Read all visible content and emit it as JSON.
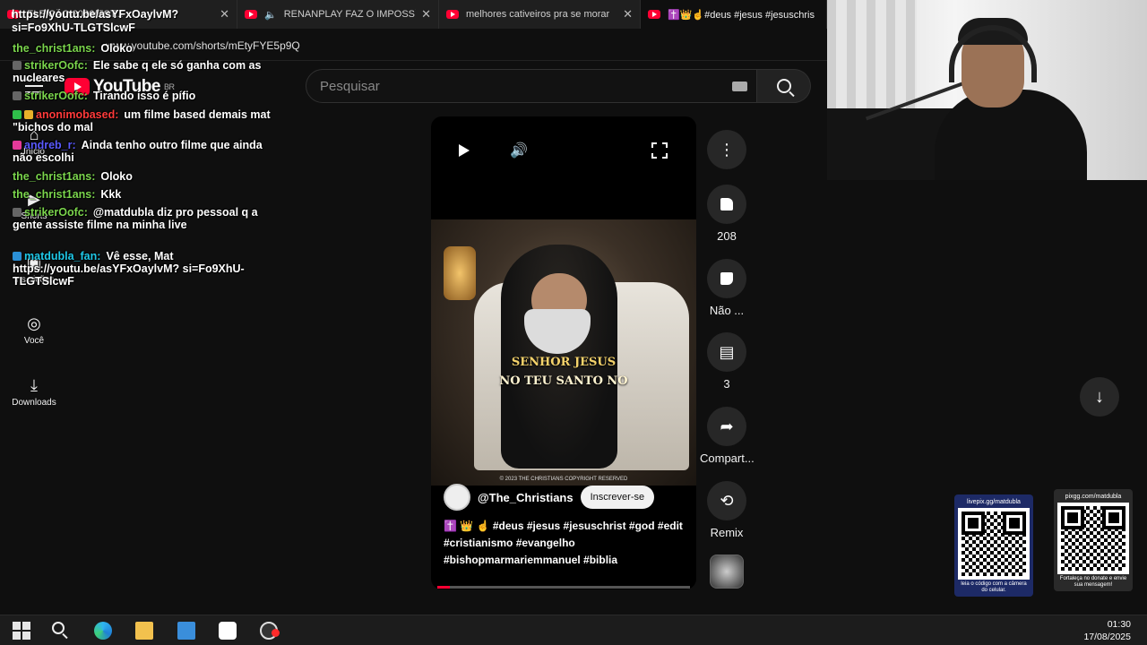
{
  "browser": {
    "tabs": [
      {
        "label": "ELEIÇÃO 2026/EST...",
        "active": false
      },
      {
        "label": "RENANPLAY FAZ O IMPOSSÍ",
        "active": false
      },
      {
        "label": "melhores cativeiros pra se morar",
        "active": false
      },
      {
        "label": "✝️👑☝️#deus #jesus #jesuschris",
        "active": true
      }
    ],
    "url": "www.youtube.com/shorts/mEtyFYE5p9Q"
  },
  "youtube": {
    "logo_text": "YouTube",
    "region": "BR",
    "search_placeholder": "Pesquisar",
    "rail": [
      {
        "icon": "home-icon",
        "label": "Início"
      },
      {
        "icon": "shorts-icon",
        "label": "Shorts"
      },
      {
        "icon": "subscriptions-icon",
        "label": "Inscrições"
      },
      {
        "icon": "you-icon",
        "label": "Você"
      },
      {
        "icon": "downloads-icon",
        "label": "Downloads"
      }
    ]
  },
  "short": {
    "caption_line1": "SENHOR JESUS",
    "caption_line2": "NO TEU SANTO NO",
    "copyright": "© 2023 THE CHRISTIANS COPYRIGHT RESERVED",
    "channel": "@The_Christians",
    "subscribe_label": "Inscrever-se",
    "description": "✝️ 👑 ☝️ #deus #jesus #jesuschrist #god #edit #cristianismo #evangelho #bishopmarmariemmanuel #biblia",
    "progress_fraction": 0.05
  },
  "actions": {
    "like_count": "208",
    "dislike_label": "Não ...",
    "comment_count": "3",
    "share_label": "Compart...",
    "remix_label": "Remix"
  },
  "chat": {
    "top_link_line1": "https://youtu.be/asYFxOaylvM?",
    "top_link_line2": "si=Fo9XhU-TLGTSlcwF",
    "messages": [
      {
        "user": "the_christ1ans:",
        "text": "Oloko",
        "color": "#7ad44c"
      },
      {
        "user": "strikerOofc:",
        "text": "Ele sabe q ele só ganha com as nucleares",
        "color": "#7ad44c"
      },
      {
        "user": "strikerOofc:",
        "text": "Tirando isso é pífio",
        "color": "#7ad44c"
      },
      {
        "user": "anonimobased:",
        "text": "um filme based demais mat \"bichos do mal",
        "color": "#ff3a3a"
      },
      {
        "user": "andreb_r:",
        "text": "Ainda tenho outro filme que ainda não escolhi",
        "color": "#5a5aff"
      },
      {
        "user": "the_christ1ans:",
        "text": "Oloko",
        "color": "#7ad44c"
      },
      {
        "user": "the_christ1ans:",
        "text": "Kkk",
        "color": "#7ad44c"
      },
      {
        "user": "strikerOofc:",
        "text": "@matdubla diz pro pessoal q a gente assiste filme na minha live",
        "color": "#7ad44c"
      },
      {
        "user": "matdubla_fan:",
        "text": "Vê esse, Mat https://youtu.be/asYFxOaylvM? si=Fo9XhU-TLGTSlcwF",
        "color": "#1fc8e8"
      }
    ]
  },
  "qr": {
    "left_title": "livepix.gg/matdubla",
    "left_foot": "leia o código com a câmera do celular.",
    "right_title": "pixgg.com/matdubla",
    "right_foot": "Fortaleça no donate e envie sua mensagem!"
  },
  "taskbar": {
    "time": "01:30",
    "date": "17/08/2025"
  },
  "colors": {
    "youtube_red": "#ff0033",
    "background": "#0f0f0f",
    "chip": "#272727"
  }
}
